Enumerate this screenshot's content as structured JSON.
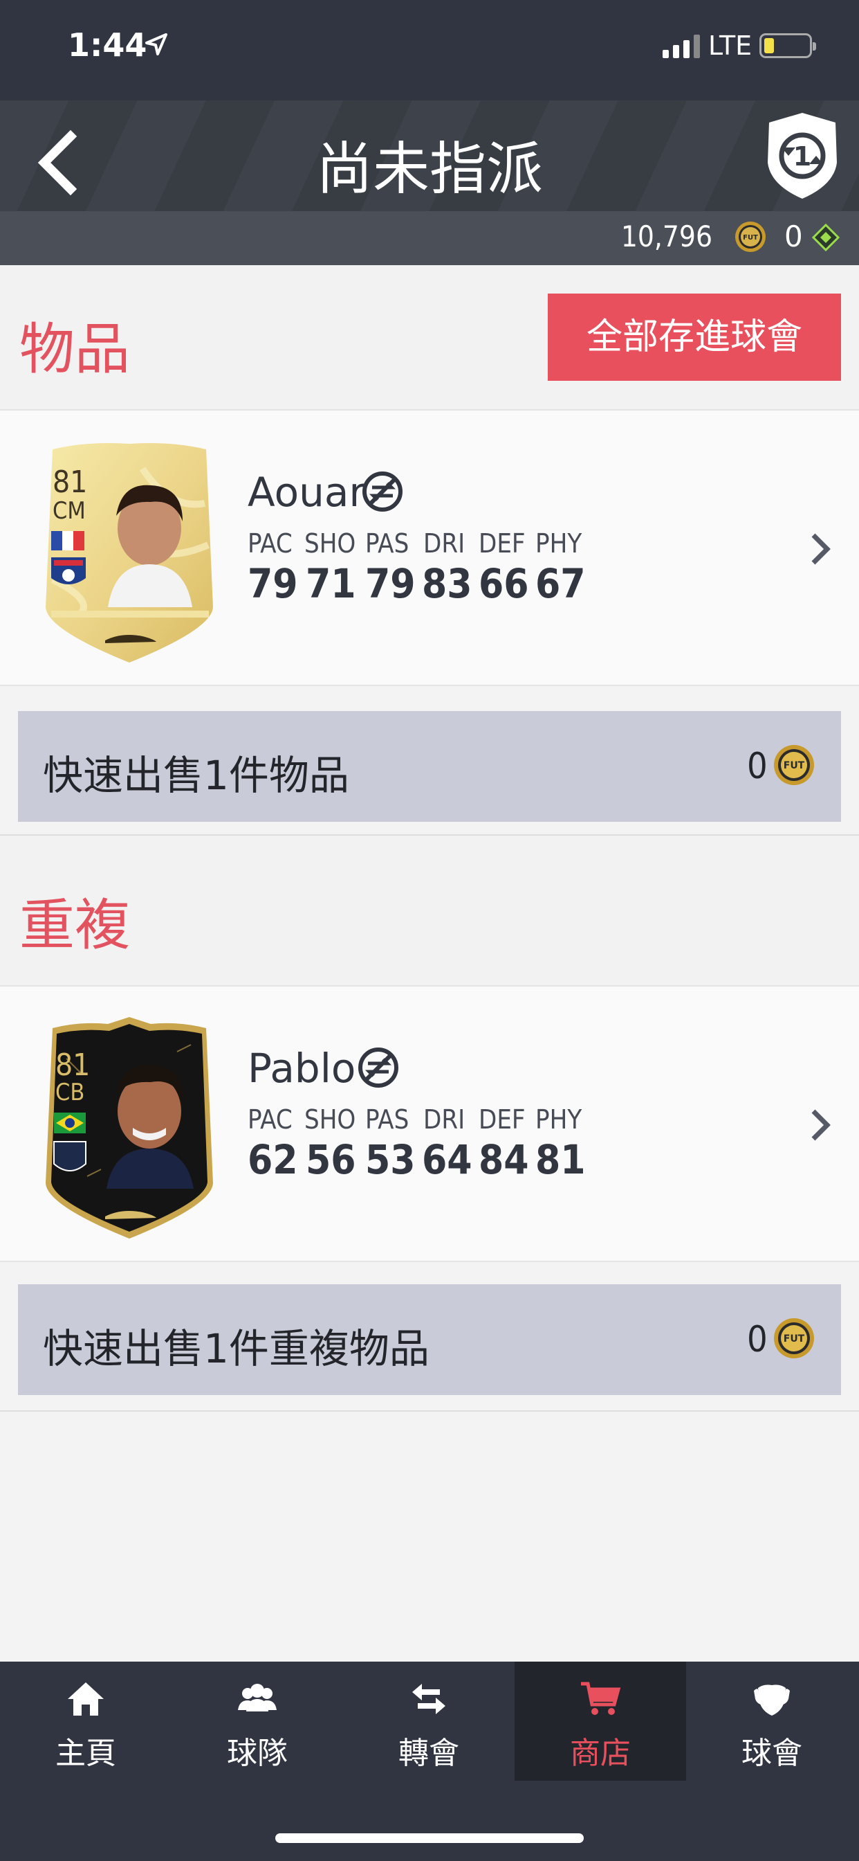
{
  "status_bar": {
    "time": "1:44",
    "network": "LTE"
  },
  "header": {
    "title": "尚未指派",
    "coins": "10,796",
    "points": "0",
    "coin_icon_label": "FUT"
  },
  "items_section": {
    "title": "物品",
    "save_all_label": "全部存進球會"
  },
  "duplicates_section": {
    "title": "重複"
  },
  "stat_headers": [
    "PAC",
    "SHO",
    "PAS",
    "DRI",
    "DEF",
    "PHY"
  ],
  "players": [
    {
      "name": "Aouar",
      "rating": "81",
      "position": "CM",
      "stats": [
        "79",
        "71",
        "79",
        "83",
        "66",
        "67"
      ],
      "card": "gold",
      "club_label": "OLYMPIQUE LYONNAIS"
    },
    {
      "name": "Pablo",
      "rating": "81",
      "position": "CB",
      "stats": [
        "62",
        "56",
        "53",
        "64",
        "84",
        "81"
      ],
      "card": "inform-black",
      "club_label": "GIRONDINS DE BORDEAUX"
    }
  ],
  "quick_sell": [
    {
      "label": "快速出售1件物品",
      "value": "0"
    },
    {
      "label": "快速出售1件重複物品",
      "value": "0"
    }
  ],
  "tabs": [
    {
      "label": "主頁",
      "icon": "home-icon"
    },
    {
      "label": "球隊",
      "icon": "squad-icon"
    },
    {
      "label": "轉會",
      "icon": "transfer-icon"
    },
    {
      "label": "商店",
      "icon": "store-cart-icon",
      "active": true
    },
    {
      "label": "球會",
      "icon": "club-icon"
    }
  ],
  "colors": {
    "accent": "#e9505d",
    "header_bg": "#3a3e46",
    "tabbar_bg": "#313541",
    "quicksell_bg": "#c9ccd8"
  }
}
